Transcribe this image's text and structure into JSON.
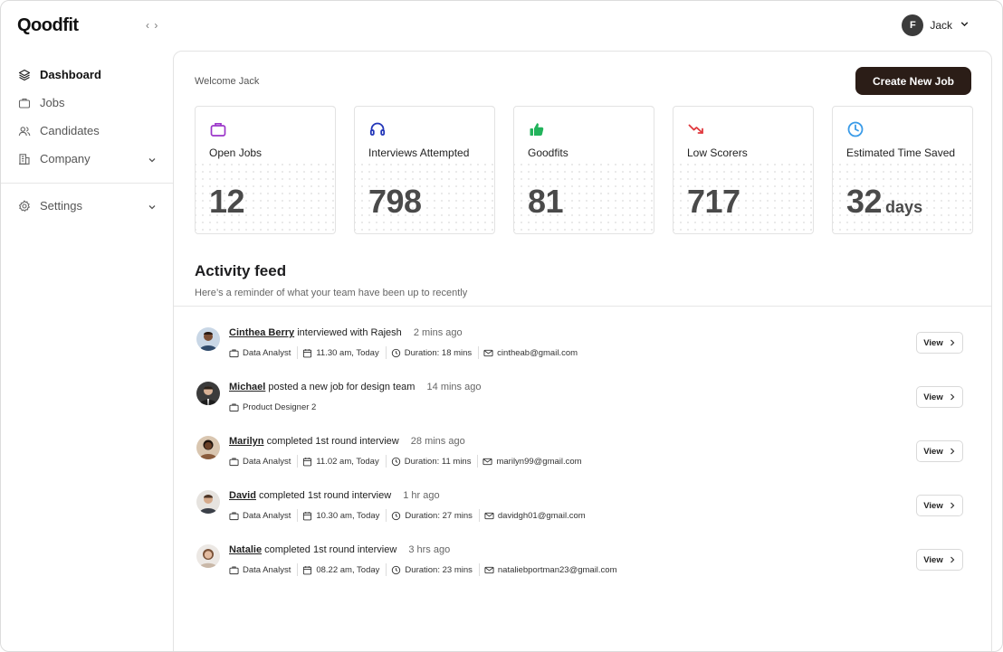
{
  "app": {
    "logo": "Qoodfit",
    "collapse_glyph": "‹ ›"
  },
  "sidebar": {
    "items": [
      {
        "label": "Dashboard",
        "icon": "layers-icon"
      },
      {
        "label": "Jobs",
        "icon": "briefcase-icon"
      },
      {
        "label": "Candidates",
        "icon": "users-icon"
      },
      {
        "label": "Company",
        "icon": "building-icon"
      }
    ],
    "settings": {
      "label": "Settings",
      "icon": "gear-icon"
    }
  },
  "user": {
    "initial": "F",
    "name": "Jack"
  },
  "main": {
    "welcome": "Welcome Jack",
    "create_label": "Create New Job",
    "stats": [
      {
        "label": "Open Jobs",
        "value": "12",
        "unit": "",
        "icon": "briefcase-icon",
        "color": "#9b36c9"
      },
      {
        "label": "Interviews Attempted",
        "value": "798",
        "unit": "",
        "icon": "headphones-icon",
        "color": "#2135b8"
      },
      {
        "label": "Goodfits",
        "value": "81",
        "unit": "",
        "icon": "thumbs-up-icon",
        "color": "#22b35b"
      },
      {
        "label": "Low Scorers",
        "value": "717",
        "unit": "",
        "icon": "trend-down-icon",
        "color": "#e0393e"
      },
      {
        "label": "Estimated Time Saved",
        "value": "32",
        "unit": "days",
        "icon": "clock-icon",
        "color": "#3a9be8"
      }
    ],
    "feed_title": "Activity feed",
    "feed_subtitle": "Here’s a reminder of what your team have been up to recently",
    "feed": [
      {
        "name": "Cinthea Berry",
        "action": "interviewed with Rajesh",
        "time": "2 mins ago",
        "role": "Data Analyst",
        "slot": "11.30 am, Today",
        "duration": "Duration: 18 mins",
        "email": "cintheab@gmail.com",
        "view": "View"
      },
      {
        "name": "Michael",
        "action": "posted a new job for design team",
        "time": "14 mins ago",
        "role": "Product Designer 2",
        "slot": "",
        "duration": "",
        "email": "",
        "view": "View"
      },
      {
        "name": "Marilyn",
        "action": "completed 1st round interview",
        "time": "28 mins ago",
        "role": "Data Analyst",
        "slot": "11.02 am, Today",
        "duration": "Duration: 11 mins",
        "email": "marilyn99@gmail.com",
        "view": "View"
      },
      {
        "name": "David",
        "action": "completed 1st round interview",
        "time": "1 hr ago",
        "role": "Data Analyst",
        "slot": "10.30 am, Today",
        "duration": "Duration: 27 mins",
        "email": "davidgh01@gmail.com",
        "view": "View"
      },
      {
        "name": "Natalie",
        "action": "completed 1st round interview",
        "time": "3 hrs ago",
        "role": "Data Analyst",
        "slot": "08.22 am, Today",
        "duration": "Duration: 23 mins",
        "email": "nataliebportman23@gmail.com",
        "view": "View"
      }
    ]
  },
  "colors": {
    "primary_button": "#2b1d17",
    "stat_value": "#4a4a4a"
  }
}
